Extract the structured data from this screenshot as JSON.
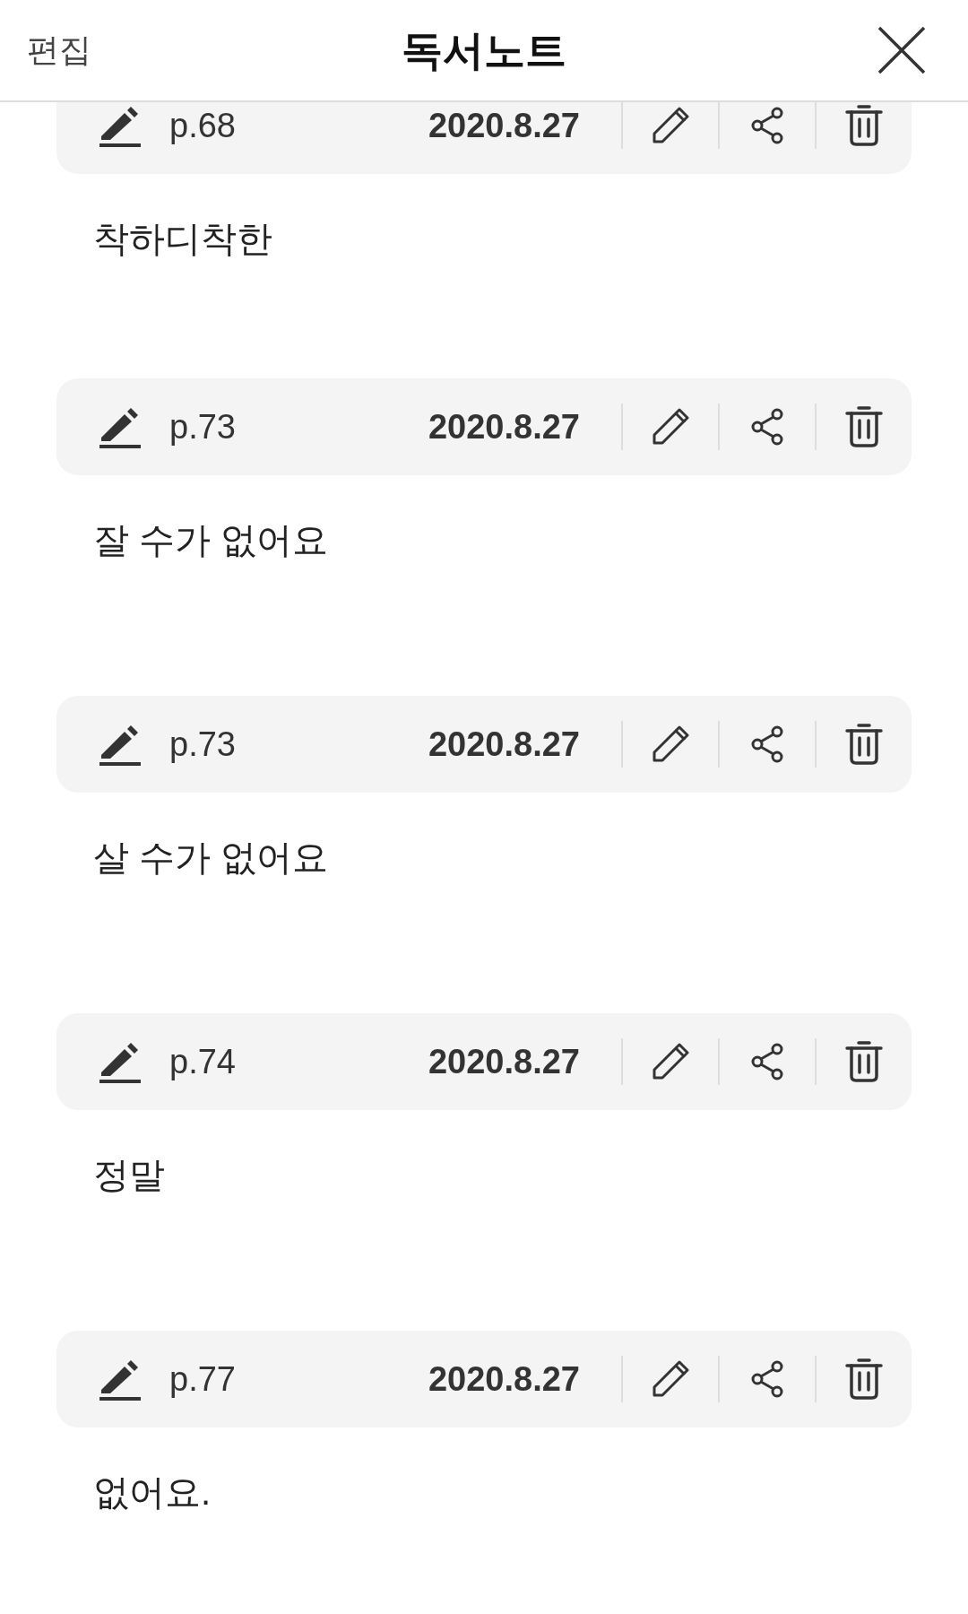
{
  "header": {
    "edit_label": "편집",
    "title": "독서노트"
  },
  "notes": [
    {
      "page": "p.68",
      "date": "2020.8.27",
      "text": "착하디착한"
    },
    {
      "page": "p.73",
      "date": "2020.8.27",
      "text": "잘 수가 없어요"
    },
    {
      "page": "p.73",
      "date": "2020.8.27",
      "text": "살 수가 없어요"
    },
    {
      "page": "p.74",
      "date": "2020.8.27",
      "text": "정말"
    },
    {
      "page": "p.77",
      "date": "2020.8.27",
      "text": "없어요."
    }
  ]
}
